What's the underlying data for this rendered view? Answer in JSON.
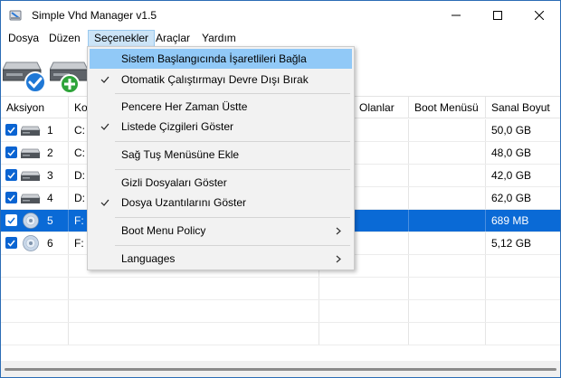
{
  "window": {
    "title": "Simple Vhd Manager v1.5"
  },
  "menubar": {
    "items": [
      "Dosya",
      "Düzen",
      "Seçenekler",
      "Araçlar",
      "Yardım"
    ],
    "active": "Seçenekler"
  },
  "table": {
    "columns": [
      "Aksiyon",
      "Ko",
      "Olanlar",
      "Boot Menüsü",
      "Sanal Boyut"
    ],
    "rows": [
      {
        "checked": true,
        "type": "hdd",
        "num": "1",
        "path": "C:",
        "size": "50,0 GB",
        "selected": false
      },
      {
        "checked": true,
        "type": "hdd",
        "num": "2",
        "path": "C:",
        "size": "48,0 GB",
        "selected": false
      },
      {
        "checked": true,
        "type": "hdd",
        "num": "3",
        "path": "D:",
        "size": "42,0 GB",
        "selected": false
      },
      {
        "checked": true,
        "type": "hdd",
        "num": "4",
        "path": "D:",
        "size": "62,0 GB",
        "selected": false
      },
      {
        "checked": true,
        "type": "disc",
        "num": "5",
        "path": "F:",
        "size": "689 MB",
        "selected": true
      },
      {
        "checked": true,
        "type": "disc",
        "num": "6",
        "path": "F:",
        "size": "5,12 GB",
        "selected": false
      }
    ]
  },
  "dropdown": {
    "items": [
      {
        "label": "Sistem Başlangıcında İşaretlileri Bağla",
        "checked": false,
        "highlighted": true
      },
      {
        "label": "Otomatik Çalıştırmayı Devre Dışı Bırak",
        "checked": true
      },
      {
        "label": "Pencere Her Zaman Üstte",
        "checked": false
      },
      {
        "label": "Listede Çizgileri Göster",
        "checked": true
      },
      {
        "label": "Sağ Tuş Menüsüne Ekle",
        "checked": false
      },
      {
        "label": "Gizli Dosyaları Göster",
        "checked": false
      },
      {
        "label": "Dosya Uzantılarını Göster",
        "checked": true
      },
      {
        "label": "Boot Menu Policy",
        "submenu": true
      },
      {
        "label": "Languages",
        "submenu": true
      }
    ]
  },
  "colors": {
    "accent": "#0a6ad6",
    "menu_highlight": "#91c9f7",
    "check_blue": "#0a64d2"
  }
}
